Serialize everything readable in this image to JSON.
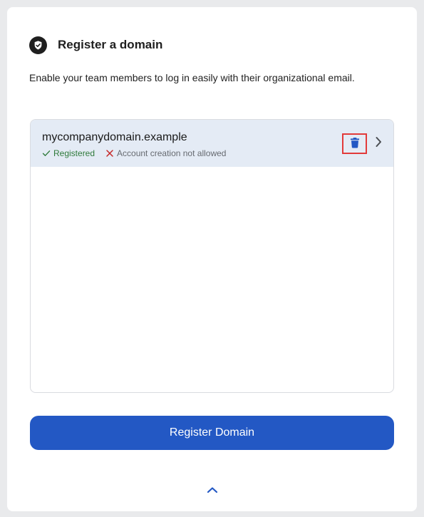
{
  "header": {
    "title": "Register a domain",
    "icon": "shield-check-icon"
  },
  "description": "Enable your team members to log in easily with their organizational email.",
  "domains": [
    {
      "name": "mycompanydomain.example",
      "status_registered": "Registered",
      "status_account_creation": "Account creation not allowed",
      "selected": true
    }
  ],
  "actions": {
    "register_button": "Register Domain",
    "delete_icon": "trash-icon",
    "open_icon": "chevron-right-icon",
    "collapse_icon": "chevron-up-icon"
  },
  "colors": {
    "accent": "#2358c4",
    "selected_row": "#e4ebf5",
    "success": "#2f7a3b",
    "danger": "#c62828",
    "highlight_border": "#e23a3a"
  }
}
